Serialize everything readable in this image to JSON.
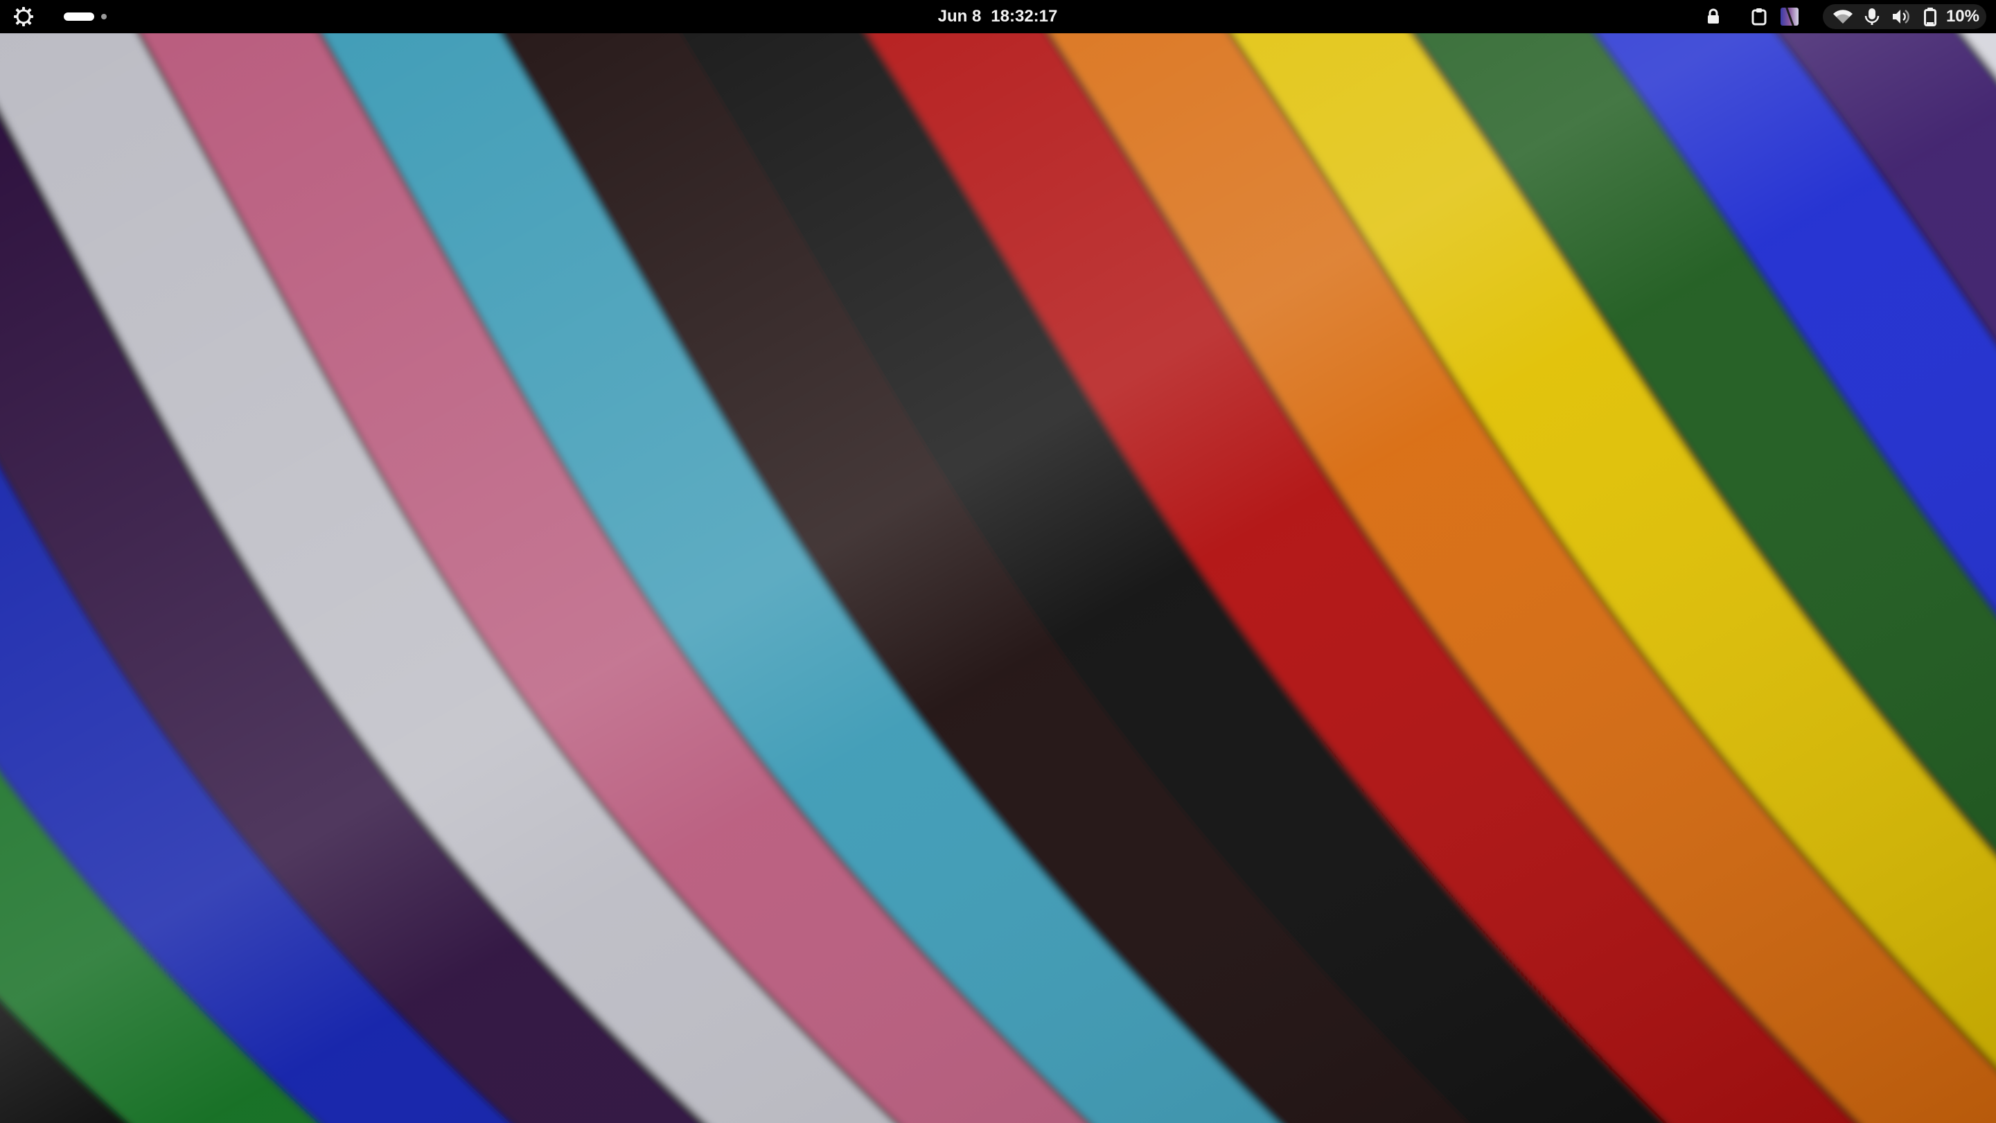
{
  "topbar": {
    "activities_icon": "gnome-activities-icon",
    "workspaces": {
      "count": 2,
      "active_index": 0
    },
    "clock": {
      "date": "Jun 8",
      "time": "18:32:17"
    },
    "tray": {
      "icons": [
        "lock-icon",
        "clipboard-icon",
        "app-indicator-icon"
      ]
    },
    "system_menu": {
      "icons": [
        "wifi-icon",
        "microphone-icon",
        "volume-icon",
        "battery-icon"
      ],
      "battery_percent": "10%"
    }
  },
  "wallpaper": {
    "description_name": "pride-stripes-wallpaper",
    "stripe_colors": [
      "#0a6b1a",
      "#0d1fa8",
      "#2a0a3a",
      "#bcbcc4",
      "#b85a7c",
      "#3a9ab5",
      "#1a0e08",
      "#111111",
      "#b00808",
      "#d86a10",
      "#e0c000",
      "#1f5a1f",
      "#1a2ad0",
      "#3a1a6a",
      "#d4d4dc"
    ]
  },
  "colors": {
    "topbar_bg": "#000000",
    "topbar_fg": "#f2f2f2",
    "system_menu_bg": "#1e1e1e"
  }
}
